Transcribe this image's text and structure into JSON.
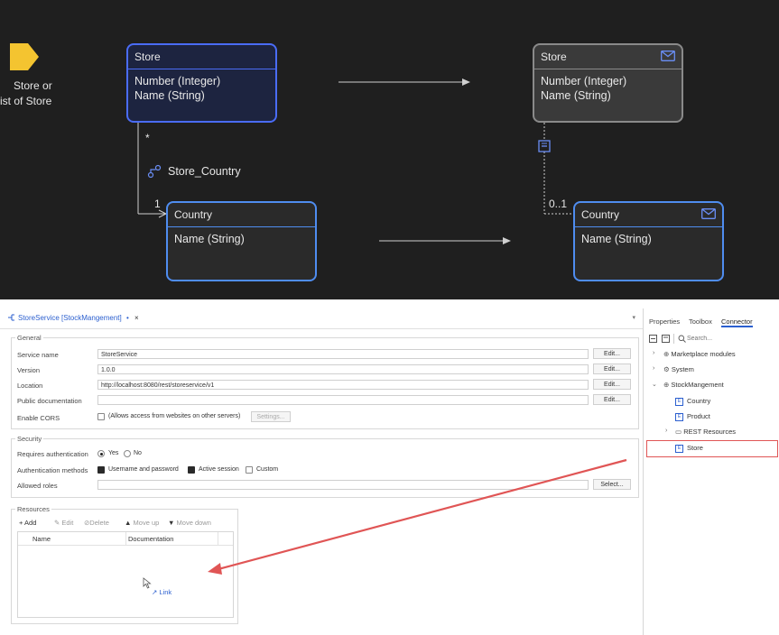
{
  "diagram": {
    "param_line1": "Store or",
    "param_line2": "ist of Store",
    "store_left": {
      "title": "Store",
      "attrs": [
        "Number (Integer)",
        "Name (String)"
      ]
    },
    "store_right": {
      "title": "Store",
      "attrs": [
        "Number (Integer)",
        "Name (String)"
      ]
    },
    "country_left": {
      "title": "Country",
      "attrs": [
        "Name (String)"
      ]
    },
    "country_right": {
      "title": "Country",
      "attrs": [
        "Name (String)"
      ]
    },
    "association_label": "Store_Country",
    "mult_many": "*",
    "mult_one": "1",
    "mult_optional": "0..1"
  },
  "editor": {
    "tab_title": "StoreService [StockMangement]",
    "tab_modified": "•",
    "tab_close": "×",
    "tab_dropdown": "▾",
    "general": {
      "label": "General",
      "service_name_label": "Service name",
      "service_name_value": "StoreService",
      "version_label": "Version",
      "version_value": "1.0.0",
      "location_label": "Location",
      "location_value": "http://localhost:8080/rest/storeservice/v1",
      "public_doc_label": "Public documentation",
      "public_doc_value": "",
      "cors_label": "Enable CORS",
      "cors_text": "(Allows access from websites on other servers)",
      "settings_button": "Settings...",
      "edit_button": "Edit..."
    },
    "security": {
      "label": "Security",
      "requires_auth_label": "Requires authentication",
      "yes": "Yes",
      "no": "No",
      "auth_methods_label": "Authentication methods",
      "method_userpass": "Username and password",
      "method_session": "Active session",
      "method_custom": "Custom",
      "allowed_roles_label": "Allowed roles",
      "select_button": "Select..."
    },
    "resources": {
      "label": "Resources",
      "add": "+ Add",
      "edit": "Edit",
      "delete": "Delete",
      "move_up": "Move up",
      "move_down": "Move down",
      "col_name": "Name",
      "col_doc": "Documentation",
      "drop_hint": "Link"
    }
  },
  "pane": {
    "tabs": [
      "Properties",
      "Toolbox",
      "Connector"
    ],
    "search_placeholder": "Search...",
    "tree": {
      "marketplace": "Marketplace modules",
      "system": "System",
      "module": "StockMangement",
      "country": "Country",
      "product": "Product",
      "rest": "REST Resources",
      "store": "Store"
    }
  },
  "colors": {
    "diagram_bg": "#1f1f1f",
    "entity_blue": "#4a6cf7",
    "highlight_red": "#e05555",
    "link_blue": "#2b5fcf"
  }
}
